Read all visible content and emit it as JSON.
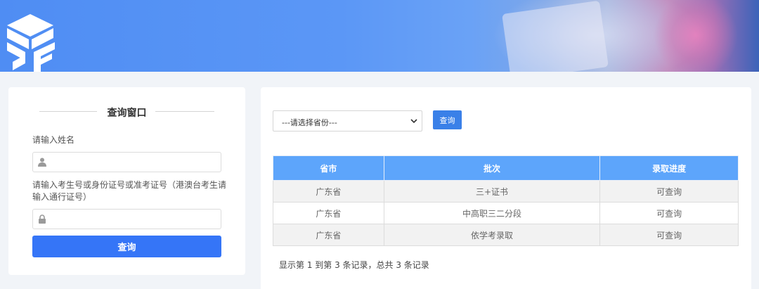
{
  "query_window": {
    "title": "查询窗口",
    "name_label": "请输入姓名",
    "name_value": "",
    "id_label": "请输入考生号或身份证号或准考证号（港澳台考生请输入通行证号）",
    "id_value": "",
    "submit_label": "查询"
  },
  "results": {
    "province_select": "---请选择省份---",
    "query_button": "查询",
    "columns": [
      "省市",
      "批次",
      "录取进度"
    ],
    "rows": [
      [
        "广东省",
        "三+证书",
        "可查询"
      ],
      [
        "广东省",
        "中高职三二分段",
        "可查询"
      ],
      [
        "广东省",
        "依学考录取",
        "可查询"
      ]
    ],
    "pagination_info": "显示第 1 到第 3 条记录，总共 3 条记录"
  },
  "icons": {
    "user": "user-icon",
    "lock": "lock-icon",
    "chevron": "chevron-down-icon",
    "logo": "site-logo"
  },
  "colors": {
    "primary_button": "#3575f7",
    "table_header": "#5da5fb",
    "banner": "#5b97f6"
  }
}
